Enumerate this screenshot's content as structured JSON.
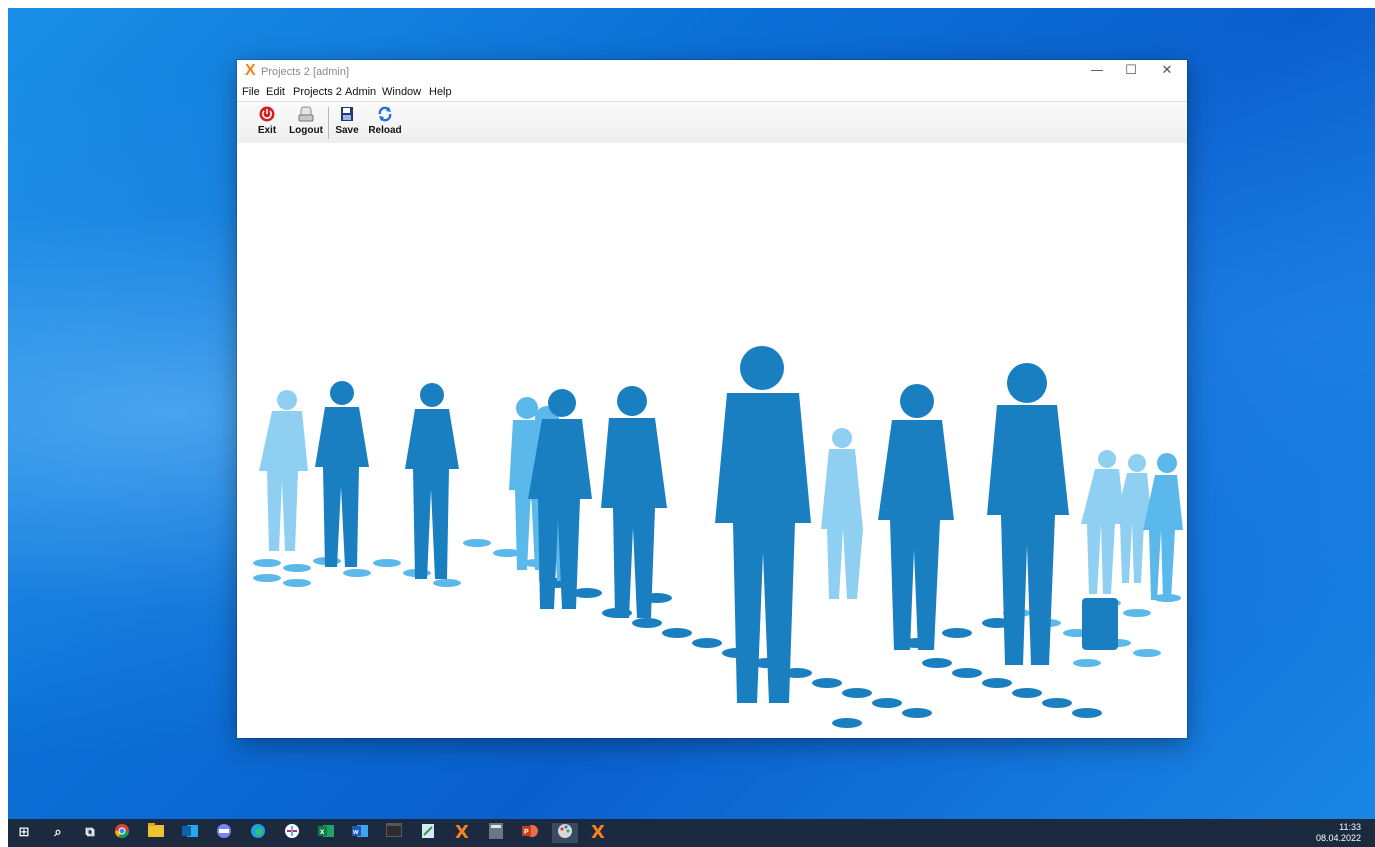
{
  "window": {
    "title": "Projects 2 [admin]",
    "icon": "x-logo-icon",
    "controls": [
      "—",
      "☐",
      "✕"
    ]
  },
  "menu": [
    "File",
    "Edit",
    "Projects 2",
    "Admin",
    "Window",
    "Help"
  ],
  "toolbar": {
    "exit_label": "Exit",
    "logout_label": "Logout",
    "save_label": "Save",
    "reload_label": "Reload"
  },
  "taskbar": {
    "time": "11:33",
    "date": "08.04.2022",
    "icons": [
      "windows-start-icon",
      "search-icon",
      "task-view-icon",
      "chrome-icon",
      "file-explorer-icon",
      "outlook-icon",
      "teams-icon",
      "edge-icon",
      "slack-icon",
      "excel-icon",
      "word-icon",
      "terminal-icon",
      "notepad-icon",
      "projects-x-icon",
      "calculator-icon",
      "powerpoint-icon",
      "paint-icon",
      "projects-x-active-icon"
    ]
  },
  "colors": {
    "accent": "#f5821f",
    "silhouette_dark": "#1a7fc1",
    "silhouette_light": "#5bb8ea",
    "silhouette_pale": "#8fd0f2"
  }
}
